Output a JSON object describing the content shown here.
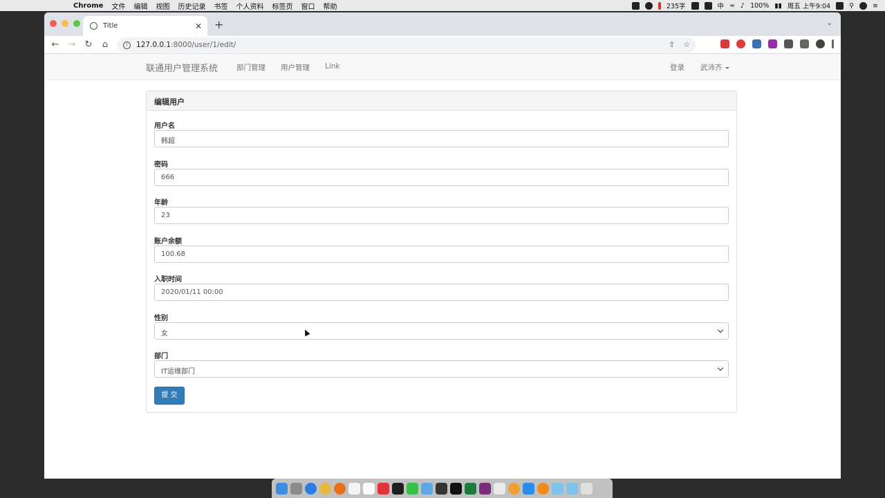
{
  "menubar": {
    "app": "Chrome",
    "items": [
      "文件",
      "编辑",
      "视图",
      "历史记录",
      "书签",
      "个人资料",
      "标签页",
      "窗口",
      "帮助"
    ],
    "status_words": "235字",
    "ime": "中",
    "battery": "100%",
    "datetime": "周五 上午9:04"
  },
  "browser": {
    "tab_title": "Title",
    "url_host": "127.0.0.1",
    "url_path": ":8000/user/1/edit/"
  },
  "navbar": {
    "brand": "联通用户管理系统",
    "links": [
      "部门管理",
      "用户管理",
      "Link"
    ],
    "login": "登录",
    "user": "武沛齐"
  },
  "panel": {
    "title": "编辑用户"
  },
  "form": {
    "fields": [
      {
        "label": "用户名",
        "value": "韩超"
      },
      {
        "label": "密码",
        "value": "666"
      },
      {
        "label": "年龄",
        "value": "23"
      },
      {
        "label": "账户余额",
        "value": "100.68"
      },
      {
        "label": "入职时间",
        "value": "2020/01/11 00:00"
      },
      {
        "label": "性别",
        "value": "女"
      },
      {
        "label": "部门",
        "value": "IT运维部门"
      }
    ],
    "submit": "提 交"
  },
  "colors": {
    "primary": "#337ab7",
    "navbar_bg": "#f8f8f8"
  }
}
